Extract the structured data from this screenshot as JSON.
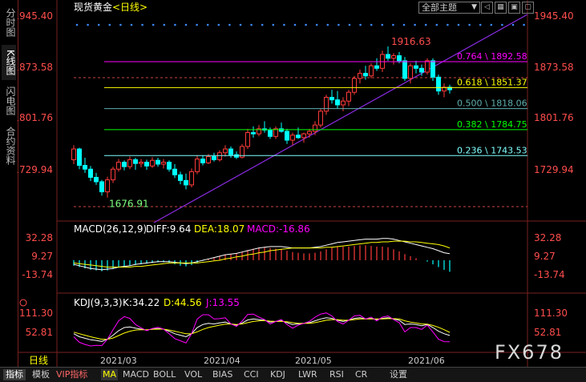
{
  "left_tabs": [
    {
      "label": "分时图",
      "active": false
    },
    {
      "label": "K线图",
      "active": true
    },
    {
      "label": "闪电图",
      "active": false
    },
    {
      "label": "合约资料",
      "active": false
    }
  ],
  "header": {
    "instrument": "现货黄金",
    "period": "<日线>",
    "theme_label": "全部主题",
    "theme_arrow": "▼"
  },
  "price_axis": {
    "ticks": [
      "1945.40",
      "1873.58",
      "1801.76",
      "1729.94"
    ]
  },
  "annotations": {
    "high_label": "1916.63",
    "low_label": "1676.91"
  },
  "fibonacci": [
    {
      "label": "0.764 \\ 1892.58",
      "value": 1892.58,
      "color": "#ff00ff"
    },
    {
      "label": "0.618 \\ 1851.37",
      "value": 1851.37,
      "color": "#ffff00"
    },
    {
      "label": "0.500 \\ 1818.06",
      "value": 1818.06,
      "color": "#5fafaf"
    },
    {
      "label": "0.382 \\ 1784.75",
      "value": 1784.75,
      "color": "#00ff00"
    },
    {
      "label": "0.236 \\ 1743.53",
      "value": 1743.53,
      "color": "#7fffff"
    }
  ],
  "macd": {
    "title": "MACD(26,12,9)",
    "diff_label": "DIFF:9.64",
    "dea_label": "DEA:18.07",
    "macd_label": "MACD:-16.86",
    "ticks": [
      "32.28",
      "9.27",
      "-13.74"
    ]
  },
  "kdj": {
    "title": "KDJ(9,3,3)",
    "k_label": "K:34.22",
    "d_label": "D:44.56",
    "j_label": "J:13.55",
    "ticks": [
      "111.30",
      "52.81"
    ]
  },
  "x_axis": {
    "period_label": "日线",
    "dates": [
      "2021/03",
      "2021/04",
      "2021/05",
      "2021/06"
    ]
  },
  "bottom_tabs": [
    "指标",
    "模板",
    "VIP指标",
    "MA",
    "MACD",
    "BOLL",
    "VOL",
    "BIAS",
    "CCI",
    "KDJ",
    "LWR",
    "RSI",
    "CR",
    "设置"
  ],
  "watermark": "FX678",
  "colors": {
    "up": "#ff3b3b",
    "down": "#00ffff",
    "trendline": "#8a2be2",
    "dotted_high": "#3b8bff"
  },
  "chart_data": {
    "type": "candlestick",
    "instrument": "现货黄金",
    "period": "日线",
    "ylim": [
      1660,
      1965
    ],
    "candles": [
      [
        1737,
        1760,
        1730,
        1754
      ],
      [
        1754,
        1756,
        1722,
        1728
      ],
      [
        1728,
        1740,
        1716,
        1722
      ],
      [
        1722,
        1727,
        1703,
        1709
      ],
      [
        1709,
        1716,
        1697,
        1702
      ],
      [
        1702,
        1705,
        1680,
        1686
      ],
      [
        1686,
        1710,
        1676.91,
        1705
      ],
      [
        1705,
        1726,
        1700,
        1722
      ],
      [
        1722,
        1738,
        1718,
        1733
      ],
      [
        1733,
        1736,
        1720,
        1726
      ],
      [
        1726,
        1742,
        1722,
        1737
      ],
      [
        1737,
        1740,
        1721,
        1731
      ],
      [
        1731,
        1738,
        1725,
        1733
      ],
      [
        1733,
        1737,
        1721,
        1727
      ],
      [
        1727,
        1741,
        1724,
        1736
      ],
      [
        1736,
        1740,
        1726,
        1730
      ],
      [
        1730,
        1738,
        1723,
        1733
      ],
      [
        1733,
        1736,
        1718,
        1722
      ],
      [
        1722,
        1730,
        1708,
        1713
      ],
      [
        1713,
        1718,
        1698,
        1704
      ],
      [
        1704,
        1715,
        1690,
        1697
      ],
      [
        1697,
        1723,
        1693,
        1718
      ],
      [
        1718,
        1744,
        1714,
        1738
      ],
      [
        1738,
        1744,
        1728,
        1732
      ],
      [
        1732,
        1746,
        1730,
        1742
      ],
      [
        1742,
        1748,
        1734,
        1737
      ],
      [
        1737,
        1752,
        1734,
        1748
      ],
      [
        1748,
        1760,
        1742,
        1754
      ],
      [
        1754,
        1758,
        1740,
        1745
      ],
      [
        1745,
        1750,
        1738,
        1741
      ],
      [
        1741,
        1762,
        1739,
        1758
      ],
      [
        1758,
        1786,
        1754,
        1780
      ],
      [
        1780,
        1790,
        1772,
        1778
      ],
      [
        1778,
        1792,
        1774,
        1786
      ],
      [
        1786,
        1798,
        1780,
        1784
      ],
      [
        1784,
        1788,
        1770,
        1774
      ],
      [
        1774,
        1790,
        1770,
        1786
      ],
      [
        1786,
        1796,
        1780,
        1782
      ],
      [
        1782,
        1786,
        1762,
        1768
      ],
      [
        1768,
        1780,
        1760,
        1776
      ],
      [
        1776,
        1788,
        1770,
        1772
      ],
      [
        1772,
        1780,
        1764,
        1778
      ],
      [
        1778,
        1786,
        1772,
        1782
      ],
      [
        1782,
        1798,
        1776,
        1792
      ],
      [
        1792,
        1818,
        1788,
        1814
      ],
      [
        1814,
        1840,
        1808,
        1836
      ],
      [
        1836,
        1848,
        1826,
        1832
      ],
      [
        1832,
        1846,
        1818,
        1824
      ],
      [
        1824,
        1836,
        1814,
        1830
      ],
      [
        1830,
        1848,
        1822,
        1844
      ],
      [
        1844,
        1870,
        1840,
        1866
      ],
      [
        1866,
        1880,
        1858,
        1874
      ],
      [
        1874,
        1886,
        1864,
        1870
      ],
      [
        1870,
        1890,
        1866,
        1886
      ],
      [
        1886,
        1898,
        1878,
        1882
      ],
      [
        1882,
        1910,
        1876,
        1904
      ],
      [
        1904,
        1916.63,
        1894,
        1898
      ],
      [
        1898,
        1906,
        1888,
        1902
      ],
      [
        1902,
        1908,
        1890,
        1894
      ],
      [
        1894,
        1900,
        1862,
        1866
      ],
      [
        1866,
        1890,
        1858,
        1886
      ],
      [
        1886,
        1894,
        1874,
        1882
      ],
      [
        1882,
        1888,
        1870,
        1876
      ],
      [
        1876,
        1898,
        1872,
        1894
      ],
      [
        1894,
        1898,
        1862,
        1868
      ],
      [
        1868,
        1872,
        1840,
        1846
      ],
      [
        1846,
        1858,
        1836,
        1852
      ],
      [
        1852,
        1856,
        1842,
        1848
      ]
    ],
    "macd_hist": [
      -8,
      -10,
      -12,
      -14,
      -15,
      -16,
      -15,
      -13,
      -11,
      -9,
      -8,
      -7,
      -6,
      -5,
      -4,
      -3,
      -3,
      -4,
      -6,
      -8,
      -9,
      -7,
      -4,
      -1,
      2,
      4,
      6,
      8,
      9,
      10,
      12,
      15,
      17,
      18,
      19,
      18,
      17,
      16,
      14,
      12,
      11,
      10,
      10,
      11,
      13,
      16,
      19,
      20,
      20,
      20,
      21,
      22,
      22,
      21,
      20,
      20,
      19,
      16,
      13,
      9,
      6,
      3,
      0,
      -2,
      -6,
      -10,
      -14,
      -16.86
    ],
    "macd_diff": [
      -6,
      -8,
      -10,
      -12,
      -13,
      -14,
      -13,
      -12,
      -10,
      -9,
      -8,
      -6,
      -5,
      -4,
      -3,
      -2,
      -2,
      -2,
      -3,
      -4,
      -5,
      -4,
      -2,
      0,
      2,
      4,
      6,
      8,
      9,
      10,
      12,
      14,
      16,
      18,
      19,
      20,
      20,
      20,
      19,
      18,
      18,
      18,
      18,
      19,
      20,
      22,
      24,
      26,
      27,
      28,
      29,
      30,
      31,
      31,
      31,
      32,
      32,
      31,
      29,
      27,
      25,
      23,
      21,
      19,
      17,
      14,
      11,
      9.64
    ],
    "macd_dea": [
      -4,
      -5,
      -6,
      -7,
      -8,
      -9,
      -10,
      -10,
      -10,
      -10,
      -10,
      -9,
      -9,
      -8,
      -7,
      -6,
      -5,
      -4,
      -4,
      -4,
      -4,
      -4,
      -4,
      -3,
      -2,
      -1,
      0,
      2,
      3,
      5,
      6,
      8,
      9,
      11,
      12,
      14,
      15,
      16,
      17,
      18,
      18,
      18,
      18,
      18,
      18,
      19,
      19,
      20,
      21,
      22,
      23,
      24,
      25,
      26,
      26,
      27,
      27,
      28,
      28,
      28,
      27,
      27,
      26,
      25,
      24,
      23,
      21,
      18.07
    ],
    "kdj_k": [
      40,
      30,
      25,
      20,
      18,
      15,
      22,
      35,
      50,
      60,
      62,
      58,
      55,
      52,
      55,
      57,
      55,
      48,
      40,
      35,
      30,
      40,
      60,
      70,
      74,
      72,
      75,
      78,
      72,
      68,
      75,
      85,
      88,
      86,
      84,
      78,
      80,
      82,
      76,
      70,
      72,
      74,
      76,
      82,
      88,
      92,
      90,
      84,
      80,
      84,
      90,
      92,
      88,
      90,
      86,
      90,
      92,
      88,
      84,
      70,
      72,
      70,
      66,
      70,
      60,
      48,
      40,
      34.22
    ],
    "kdj_d": [
      45,
      40,
      35,
      30,
      26,
      22,
      22,
      26,
      34,
      42,
      48,
      52,
      53,
      53,
      54,
      55,
      55,
      52,
      48,
      44,
      40,
      40,
      46,
      54,
      60,
      64,
      68,
      71,
      72,
      70,
      72,
      76,
      80,
      82,
      83,
      81,
      80,
      80,
      79,
      76,
      74,
      74,
      74,
      76,
      80,
      84,
      86,
      86,
      84,
      84,
      86,
      88,
      88,
      88,
      88,
      88,
      89,
      89,
      88,
      82,
      78,
      75,
      72,
      71,
      67,
      61,
      53,
      44.56
    ],
    "kdj_j": [
      30,
      12,
      5,
      0,
      2,
      1,
      22,
      53,
      82,
      96,
      90,
      70,
      59,
      50,
      57,
      61,
      55,
      40,
      24,
      17,
      10,
      40,
      88,
      102,
      102,
      88,
      89,
      92,
      72,
      64,
      81,
      103,
      104,
      94,
      86,
      72,
      80,
      86,
      70,
      58,
      68,
      74,
      80,
      94,
      104,
      108,
      98,
      80,
      72,
      84,
      98,
      100,
      88,
      94,
      82,
      94,
      98,
      86,
      76,
      46,
      60,
      60,
      54,
      68,
      46,
      22,
      14,
      13.55
    ]
  }
}
